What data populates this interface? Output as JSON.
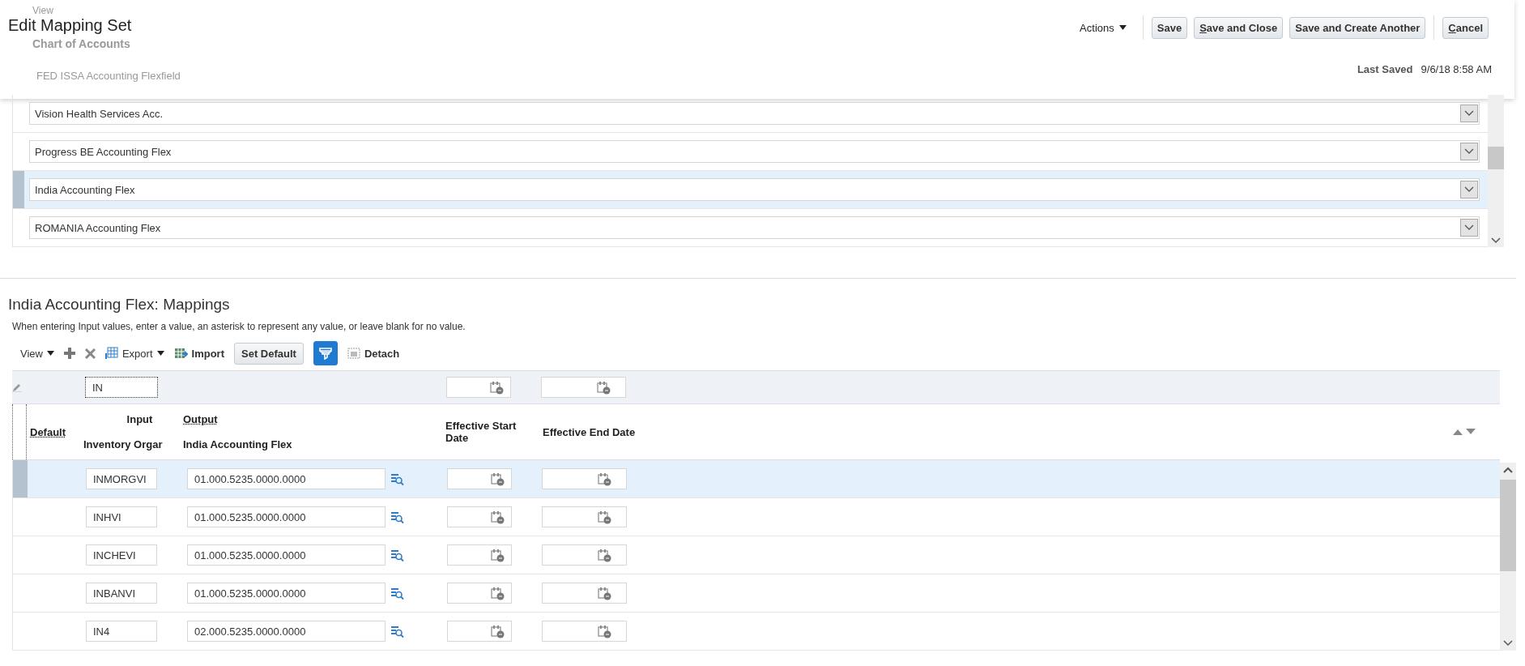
{
  "page_header": {
    "title": "Edit Mapping Set",
    "actions_menu": "Actions",
    "buttons": [
      {
        "label": "Save",
        "underline_first": false
      },
      {
        "label": "Save and Close",
        "underline_first": true
      },
      {
        "label": "Save and Create Another",
        "underline_first": false
      },
      {
        "label": "Cancel",
        "underline_first": true
      }
    ],
    "last_saved_label": "Last Saved",
    "last_saved_value": "9/6/18 8:58 AM"
  },
  "chart_of_accounts_table": {
    "view_menu": "View",
    "column": "Chart of Accounts",
    "partly_hidden_row": "FED ISSA Accounting Flexfield",
    "rows": [
      {
        "value": "Vision Health Services Acc.",
        "selected": false
      },
      {
        "value": "Progress BE Accounting Flex",
        "selected": false
      },
      {
        "value": "India Accounting Flex",
        "selected": true
      },
      {
        "value": "ROMANIA Accounting Flex",
        "selected": false
      }
    ]
  },
  "mappings": {
    "title": "India Accounting Flex: Mappings",
    "instructions": "When entering Input values, enter a value, an asterisk to represent any value, or leave blank for no value.",
    "toolbar": {
      "view": "View",
      "export": "Export",
      "import": "Import",
      "set_default": "Set Default",
      "query_by_example_on": true,
      "detach": "Detach"
    },
    "filter": {
      "input": "IN"
    },
    "columns": {
      "default": "Default",
      "input_group": "Input",
      "input": "Inventory Orgar",
      "output_group": "Output",
      "output": "India Accounting Flex",
      "start_date": "Effective Start Date",
      "end_date": "Effective End Date"
    },
    "rows": [
      {
        "input": "INMORGVI",
        "output": "01.000.5235.0000.0000",
        "selected": true
      },
      {
        "input": "INHVI",
        "output": "01.000.5235.0000.0000",
        "selected": false
      },
      {
        "input": "INCHEVI",
        "output": "01.000.5235.0000.0000",
        "selected": false
      },
      {
        "input": "INBANVI",
        "output": "01.000.5235.0000.0000",
        "selected": false
      },
      {
        "input": "IN4",
        "output": "02.000.5235.0000.0000",
        "selected": false
      }
    ]
  }
}
